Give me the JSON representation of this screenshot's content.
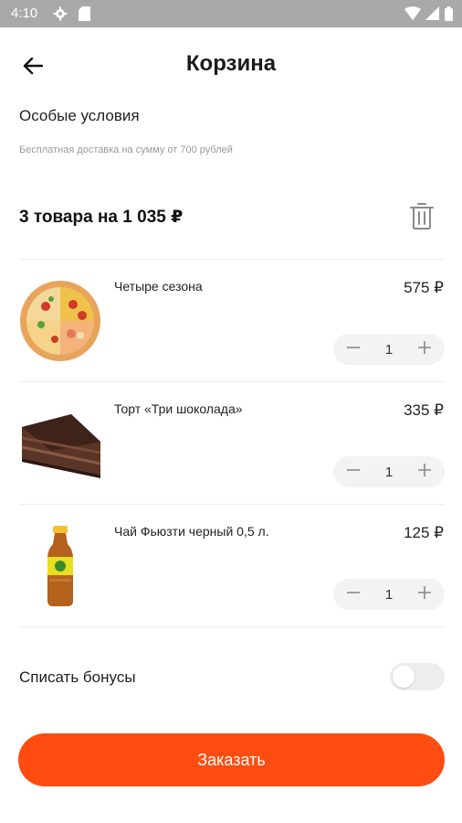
{
  "status_bar": {
    "time": "4:10",
    "icons": [
      "gear-icon",
      "sd-card-icon",
      "wifi-icon",
      "signal-icon",
      "battery-icon"
    ]
  },
  "header": {
    "title": "Корзина",
    "back_icon": "arrow-left-icon"
  },
  "conditions": {
    "title": "Особые условия",
    "subtitle": "Бесплатная доставка на сумму от 700 рублей"
  },
  "cart": {
    "summary": "3 товара на 1 035 ₽",
    "clear_icon": "trash-icon",
    "items": [
      {
        "name": "Четыре сезона",
        "price": "575 ₽",
        "qty": "1",
        "image": "pizza-image"
      },
      {
        "name": "Торт «Три шоколада»",
        "price": "335 ₽",
        "qty": "1",
        "image": "cake-image"
      },
      {
        "name": "Чай Фьюзти черный 0,5 л.",
        "price": "125 ₽",
        "qty": "1",
        "image": "tea-bottle-image"
      }
    ]
  },
  "bonus": {
    "label": "Списать бонусы",
    "enabled": false
  },
  "order_button": {
    "label": "Заказать"
  },
  "colors": {
    "accent": "#ff4c11",
    "status_bar": "#a9a9a9",
    "stepper_bg": "#f3f3f3",
    "muted_text": "#9a9a9a"
  }
}
